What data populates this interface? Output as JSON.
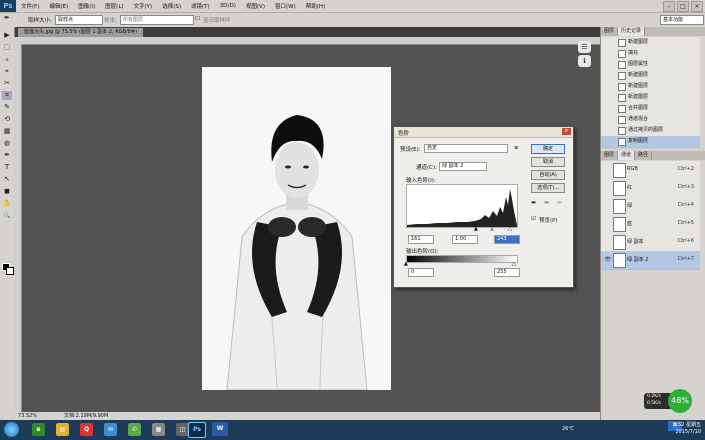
{
  "app": {
    "logo": "Ps"
  },
  "menu": [
    "文件(F)",
    "编辑(E)",
    "图像(I)",
    "图层(L)",
    "文字(Y)",
    "选择(S)",
    "滤镜(T)",
    "3D(D)",
    "视图(V)",
    "窗口(W)",
    "帮助(H)"
  ],
  "window_controls": [
    "–",
    "□",
    "×"
  ],
  "options": {
    "brush_label": "取样大小:",
    "brush_value": "取样点",
    "sample_label": "样本:",
    "sample_value": "所有图层",
    "show_ring": "显示取样环",
    "workspace": "基本功能"
  },
  "doc_tab": "蓝莲大头.jpg @ 73.5% (图层 1 副本 2, RGB/8#)",
  "tools": [
    "▶",
    "⬚",
    "ℴ",
    "⌖",
    "✂",
    "⌗",
    "✎",
    "⟲",
    "▦",
    "◍",
    "✒",
    "T",
    "↖",
    "◼",
    "✋",
    "🔍"
  ],
  "status": {
    "zoom": "73.52%",
    "doc": "文档:2.19M/9.90M"
  },
  "history": {
    "tabs": [
      "图层",
      "历史记录"
    ],
    "items": [
      "新建图层",
      "填充",
      "图层属性",
      "新建图层",
      "新建图层",
      "新建图层",
      "合并图层",
      "通道混合",
      "通过拷贝的图层",
      "复制图层"
    ]
  },
  "channels": {
    "tabs": [
      "图层",
      "通道",
      "路径"
    ],
    "rows": [
      {
        "name": "RGB",
        "shortcut": "Ctrl+2"
      },
      {
        "name": "红",
        "shortcut": "Ctrl+3"
      },
      {
        "name": "绿",
        "shortcut": "Ctrl+4"
      },
      {
        "name": "蓝",
        "shortcut": "Ctrl+5"
      },
      {
        "name": "绿 副本",
        "shortcut": "Ctrl+6"
      },
      {
        "name": "绿 副本 2",
        "shortcut": "Ctrl+7"
      }
    ]
  },
  "levels": {
    "title": "色阶",
    "preset_label": "预设(E):",
    "preset_value": "自定",
    "channel_label": "通道(C):",
    "channel_value": "绿 副本 2",
    "input_label": "输入色阶(I):",
    "input_values": [
      "161",
      "1.00",
      "243"
    ],
    "output_label": "输出色阶(O):",
    "output_values": [
      "0",
      "255"
    ],
    "buttons": [
      "确定",
      "取消",
      "自动(A)",
      "选项(T)..."
    ],
    "preview_label": "预览(P)",
    "preview_checked": true
  },
  "taskbar": {
    "time": "9:52 星期五",
    "date": "2015/7/10",
    "temp": "26℃",
    "lang": "中"
  },
  "speed_widget": {
    "up": "0.2K/s",
    "down": "0.5K/s",
    "percent": "48%"
  }
}
